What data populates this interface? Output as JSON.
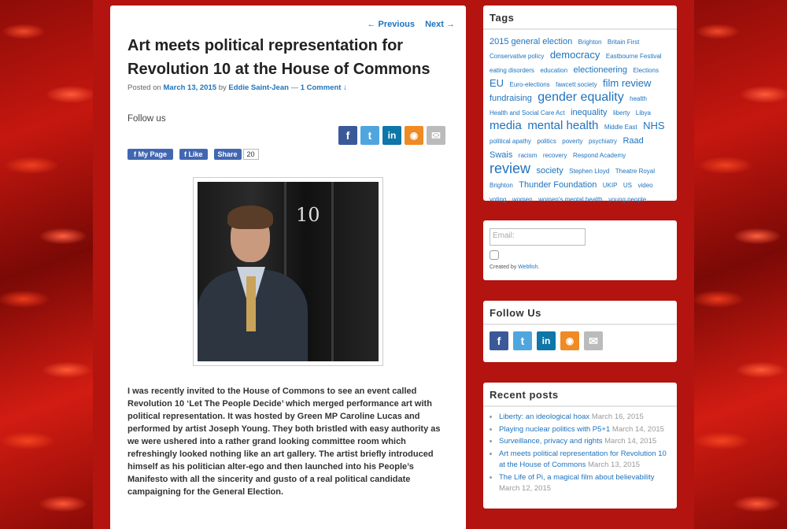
{
  "article": {
    "nav_previous": "← Previous",
    "nav_next": "Next →",
    "title": "Art meets political representation for Revolution 10 at the House of Commons",
    "posted_on": "Posted on",
    "date": "March 13, 2015",
    "by": "by",
    "author": "Eddie Saint-Jean",
    "separator": "—",
    "comments": "1 Comment ↓",
    "follow_us": "Follow us",
    "my_page_label": "f  My Page",
    "like_label": "Like",
    "share_label": "Share",
    "share_count": "20",
    "door_number": "10",
    "body": "I was recently invited to the House of Commons to see an event called Revolution 10 ‘Let The People Decide’ which merged performance art with political representation. It was hosted by Green MP Caroline Lucas and performed by artist Joseph Young.  They  both bristled with easy authority as we were ushered into a rather grand looking committee room which refreshingly looked nothing like an art gallery. The artist briefly introduced himself as his politician alter-ego and then launched into his People’s Manifesto with all the sincerity and gusto of a real political candidate campaigning for the General Election."
  },
  "social_icons": [
    {
      "name": "facebook-icon",
      "glyph": "f",
      "style": "fb"
    },
    {
      "name": "twitter-icon",
      "glyph": "t",
      "style": "tw"
    },
    {
      "name": "linkedin-icon",
      "glyph": "in",
      "style": "li"
    },
    {
      "name": "rss-icon",
      "glyph": "◉",
      "style": "rss"
    },
    {
      "name": "email-icon",
      "glyph": "✉",
      "style": "mail"
    }
  ],
  "tags_widget": {
    "title": "Tags",
    "tags": [
      {
        "text": "2015 general election",
        "size": 11
      },
      {
        "text": "Brighton",
        "size": 8
      },
      {
        "text": "Britain First",
        "size": 8
      },
      {
        "text": "Conservative policy",
        "size": 8
      },
      {
        "text": "democracy",
        "size": 13
      },
      {
        "text": "Eastbourne Festival",
        "size": 8
      },
      {
        "text": "eating disorders",
        "size": 8
      },
      {
        "text": "education",
        "size": 8
      },
      {
        "text": "electioneering",
        "size": 11
      },
      {
        "text": "Elections",
        "size": 8
      },
      {
        "text": "EU",
        "size": 13
      },
      {
        "text": "Euro-elections",
        "size": 8
      },
      {
        "text": "fawcett society",
        "size": 8
      },
      {
        "text": "film review",
        "size": 13
      },
      {
        "text": "fundraising",
        "size": 11
      },
      {
        "text": "gender equality",
        "size": 16
      },
      {
        "text": "health",
        "size": 8
      },
      {
        "text": "Health and Social Care Act",
        "size": 8
      },
      {
        "text": "inequality",
        "size": 11
      },
      {
        "text": "liberty",
        "size": 8
      },
      {
        "text": "Libya",
        "size": 8
      },
      {
        "text": "media",
        "size": 15
      },
      {
        "text": "mental health",
        "size": 15
      },
      {
        "text": "Middle East",
        "size": 8
      },
      {
        "text": "NHS",
        "size": 13
      },
      {
        "text": "political apathy",
        "size": 8
      },
      {
        "text": "politics",
        "size": 8
      },
      {
        "text": "poverty",
        "size": 8
      },
      {
        "text": "psychiatry",
        "size": 8
      },
      {
        "text": "Raad Swais",
        "size": 11
      },
      {
        "text": "racism",
        "size": 8
      },
      {
        "text": "recovery",
        "size": 8
      },
      {
        "text": "Respond Academy",
        "size": 8
      },
      {
        "text": "review",
        "size": 18
      },
      {
        "text": "society",
        "size": 11
      },
      {
        "text": "Stephen Lloyd",
        "size": 8
      },
      {
        "text": "Theatre Royal Brighton",
        "size": 8
      },
      {
        "text": "Thunder Foundation",
        "size": 11
      },
      {
        "text": "UKIP",
        "size": 8
      },
      {
        "text": "US",
        "size": 8
      },
      {
        "text": "video",
        "size": 8
      },
      {
        "text": "voting",
        "size": 8
      },
      {
        "text": "women",
        "size": 8
      },
      {
        "text": "women's mental health",
        "size": 8
      },
      {
        "text": "young people",
        "size": 8
      }
    ]
  },
  "subscribe_widget": {
    "email_placeholder": "Email:",
    "created_prefix": "Created by",
    "created_link": "Webfish",
    "created_suffix": "."
  },
  "follow_widget": {
    "title": "Follow Us"
  },
  "recent_widget": {
    "title": "Recent posts",
    "posts": [
      {
        "title": "Liberty: an ideological hoax",
        "date": "March 16, 2015"
      },
      {
        "title": "Playing nuclear politics with P5+1",
        "date": "March 14, 2015"
      },
      {
        "title": "Surveillance, privacy and rights",
        "date": "March 14, 2015"
      },
      {
        "title": "Art meets political representation for Revolution 10 at the House of Commons",
        "date": "March 13, 2015"
      },
      {
        "title": "The Life of Pi, a magical film about believability",
        "date": "March 12, 2015"
      }
    ]
  },
  "colors": {
    "link": "#1e73be",
    "background": "#b3140f"
  }
}
